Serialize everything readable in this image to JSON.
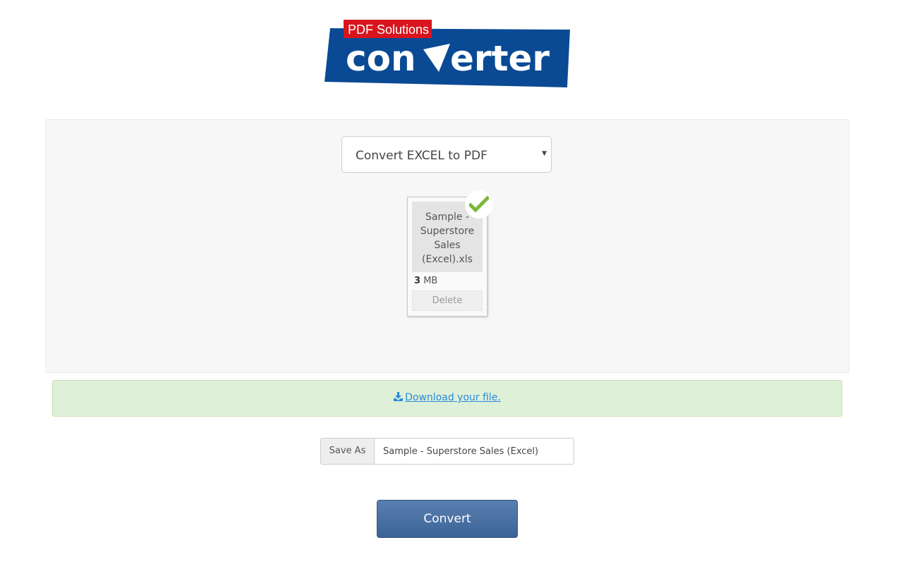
{
  "logo": {
    "badge_text": "PDF Solutions",
    "word_part1": "con",
    "word_part2": "erter",
    "brand_blue": "#0a4a94",
    "badge_red": "#d9141d"
  },
  "converter_select": {
    "selected": "Convert EXCEL to PDF"
  },
  "file_card": {
    "name": "Sample - Superstore Sales (Excel).xls",
    "size_value": "3",
    "size_unit": "MB",
    "delete_label": "Delete",
    "status_icon": "check-icon",
    "status_color": "#7ab839"
  },
  "download": {
    "icon": "download-icon",
    "link_text": "Download your file.",
    "bg_color": "#dff0d8",
    "link_color": "#2a8bd8"
  },
  "save_as": {
    "label": "Save As",
    "value": "Sample - Superstore Sales (Excel)"
  },
  "convert_button": {
    "label": "Convert",
    "color": "#3b6496"
  }
}
